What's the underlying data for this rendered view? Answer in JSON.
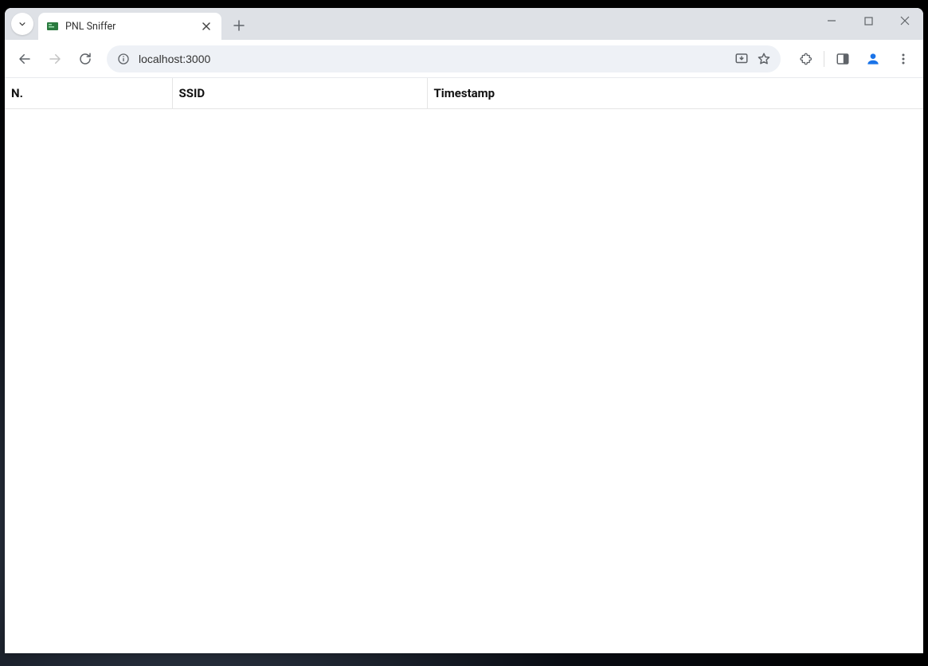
{
  "browser": {
    "tab": {
      "title": "PNL Sniffer"
    },
    "address": "localhost:3000"
  },
  "table": {
    "columns": [
      {
        "key": "n",
        "label": "N."
      },
      {
        "key": "ssid",
        "label": "SSID"
      },
      {
        "key": "timestamp",
        "label": "Timestamp"
      }
    ],
    "rows": []
  }
}
